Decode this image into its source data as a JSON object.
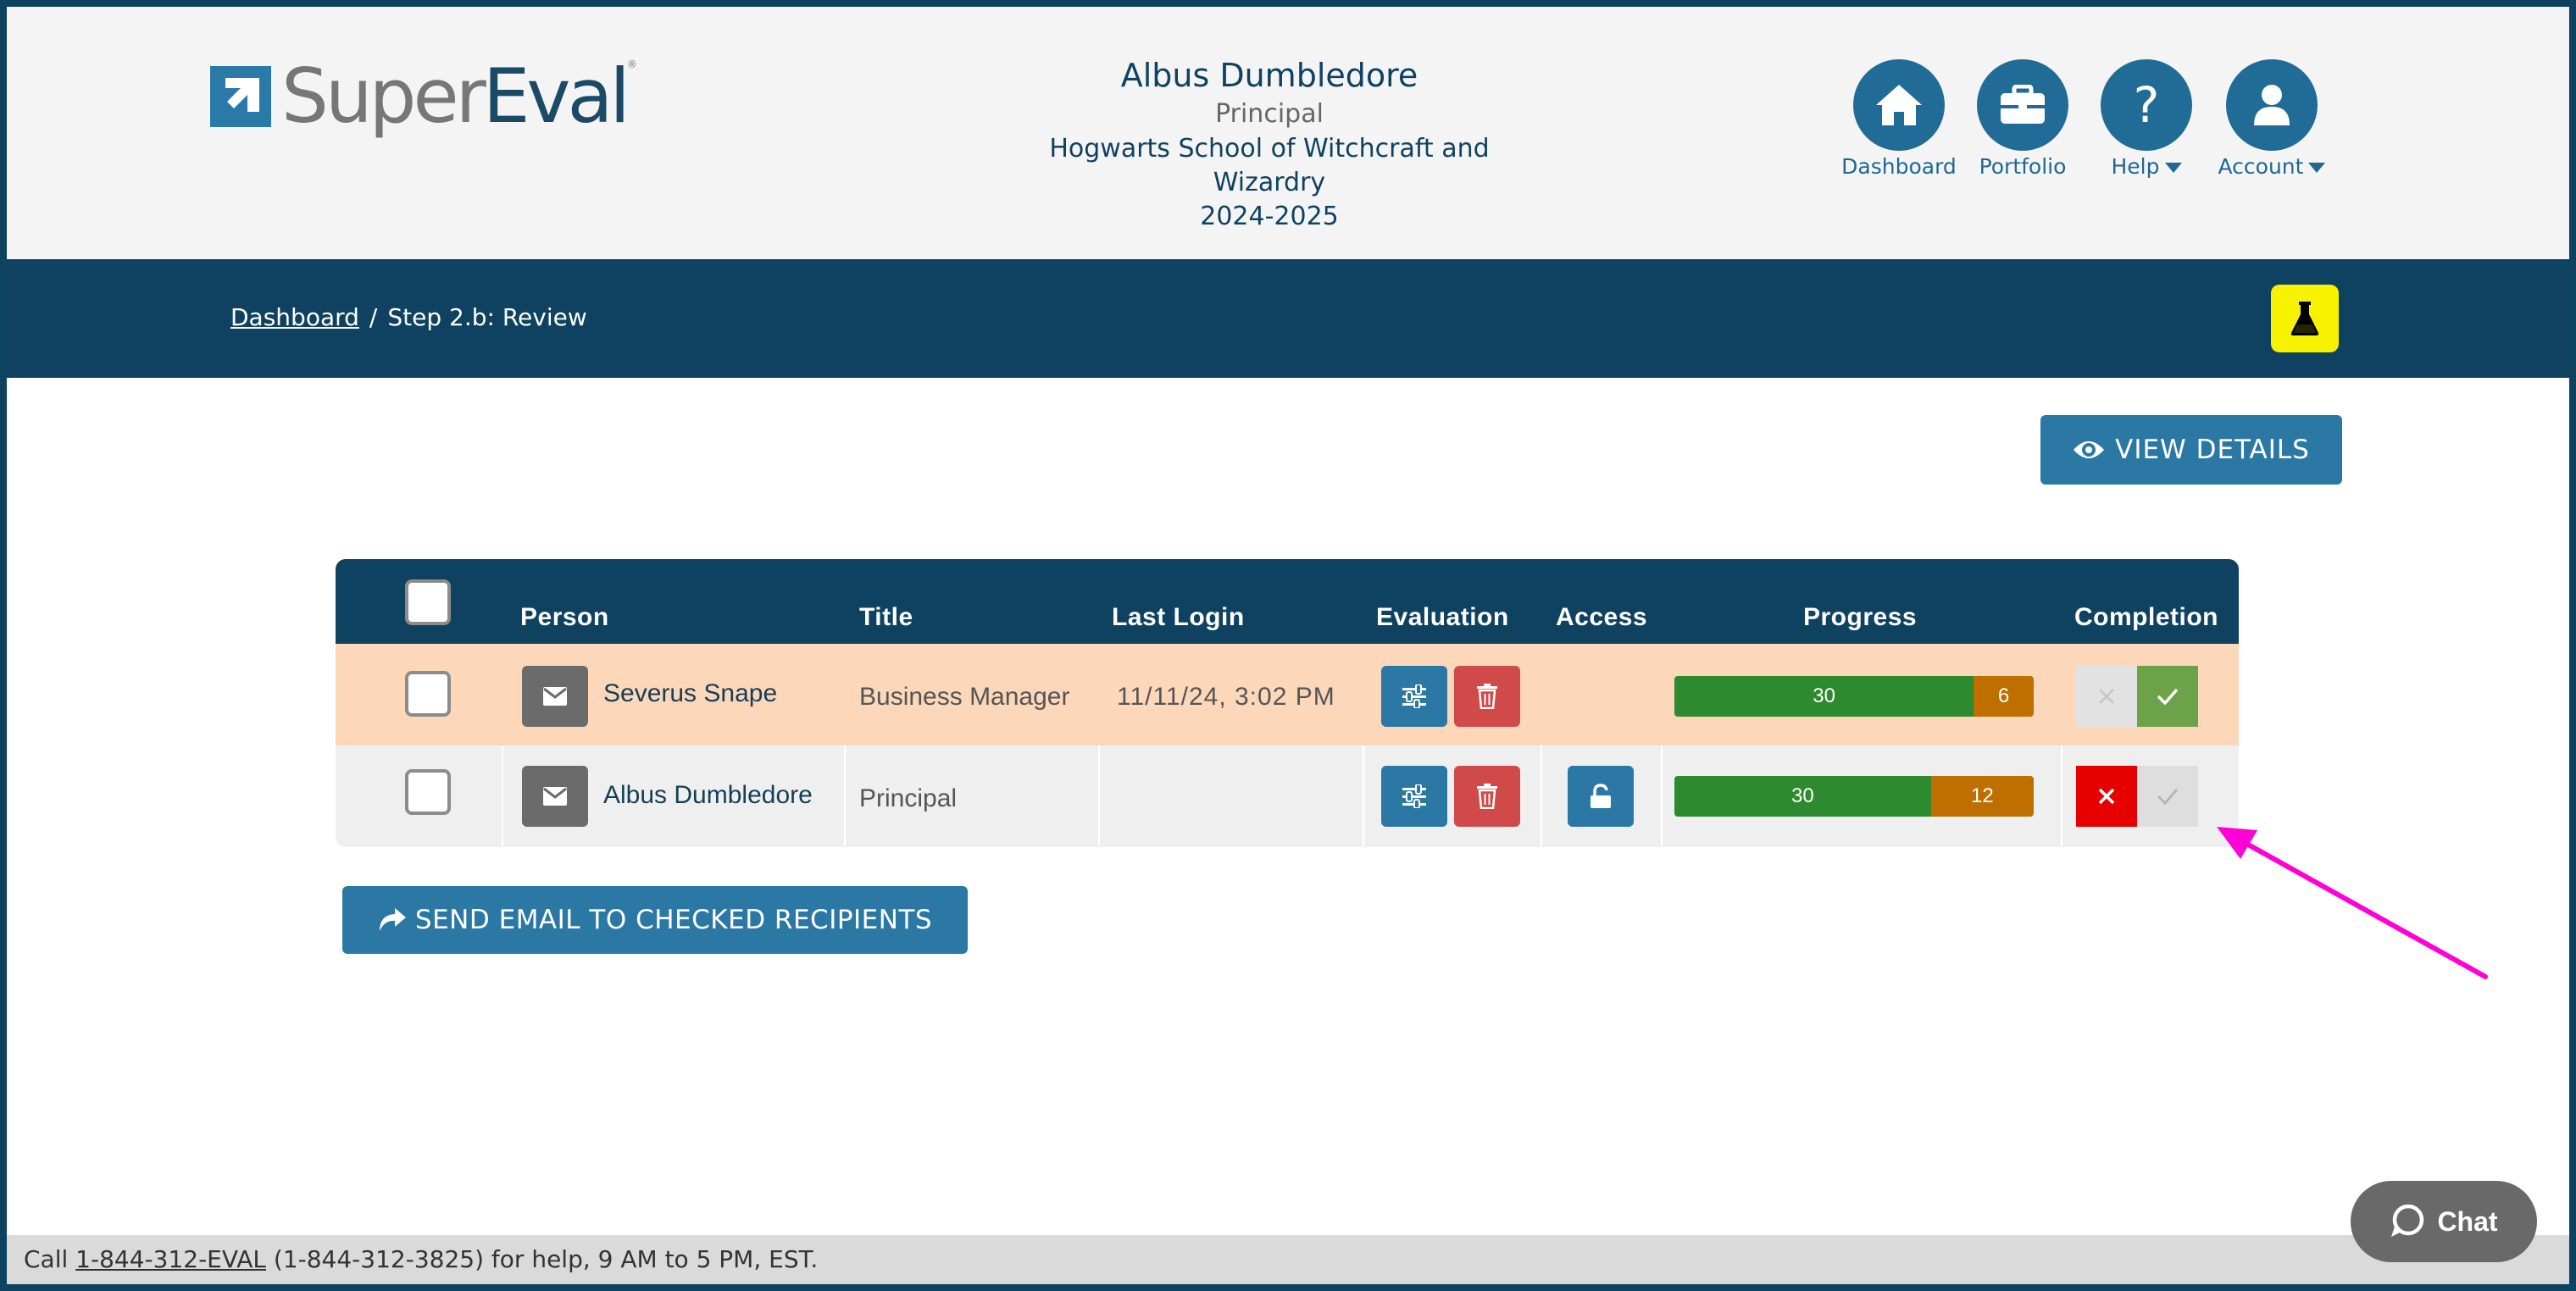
{
  "brand": {
    "logo_part1": "Super",
    "logo_part2": "Eval",
    "registered": "®"
  },
  "user": {
    "name": "Albus Dumbledore",
    "role": "Principal",
    "school": "Hogwarts School of Witchcraft and Wizardry",
    "year": "2024-2025"
  },
  "nav": {
    "dashboard": "Dashboard",
    "portfolio": "Portfolio",
    "help": "Help",
    "account": "Account"
  },
  "breadcrumb": {
    "root": "Dashboard",
    "separator": "/",
    "current": "Step 2.b: Review"
  },
  "actions": {
    "view_details": "VIEW DETAILS",
    "send_email": "SEND EMAIL TO CHECKED RECIPIENTS"
  },
  "table": {
    "headers": {
      "person": "Person",
      "title": "Title",
      "last_login": "Last Login",
      "evaluation": "Evaluation",
      "access": "Access",
      "progress": "Progress",
      "completion": "Completion"
    },
    "rows": [
      {
        "person": "Severus Snape",
        "title": "Business Manager",
        "last_login": "11/11/24, 3:02 PM",
        "progress_done": "30",
        "progress_remaining": "6",
        "progress_fraction": 0.833,
        "has_access_lock": false,
        "completion_state": "complete"
      },
      {
        "person": "Albus Dumbledore",
        "title": "Principal",
        "last_login": "",
        "progress_done": "30",
        "progress_remaining": "12",
        "progress_fraction": 0.714,
        "has_access_lock": true,
        "completion_state": "incomplete"
      }
    ]
  },
  "footer": {
    "prefix": "Call ",
    "phone": "1-844-312-EVAL",
    "suffix": " (1-844-312-3825) for help, 9 AM to 5 PM, EST."
  },
  "chat": {
    "label": "Chat"
  },
  "colors": {
    "brand_dark": "#0e4260",
    "brand_blue": "#2b78a4",
    "highlight_row": "#fdd7b9",
    "progress_green": "#2e8a2e",
    "progress_orange": "#be6f00",
    "arrow_magenta": "#ff00d6",
    "lab_yellow": "#f7f200"
  }
}
